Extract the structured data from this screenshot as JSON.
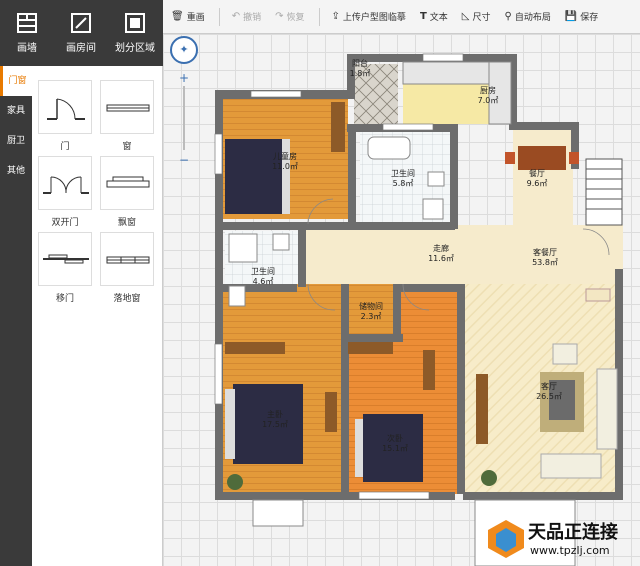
{
  "tools": [
    {
      "label": "画墙",
      "icon": "draw-wall-icon"
    },
    {
      "label": "画房间",
      "icon": "draw-room-icon"
    },
    {
      "label": "划分区域",
      "icon": "divide-area-icon"
    }
  ],
  "toolbar": [
    {
      "label": "重画",
      "icon": "trash-icon",
      "enabled": true
    },
    {
      "label": "撤销",
      "icon": "undo-icon",
      "enabled": false
    },
    {
      "label": "恢复",
      "icon": "redo-icon",
      "enabled": false
    },
    {
      "label": "上传户型图临摹",
      "icon": "upload-icon",
      "enabled": true
    },
    {
      "label": "文本",
      "icon": "text-icon",
      "enabled": true
    },
    {
      "label": "尺寸",
      "icon": "ruler-icon",
      "enabled": true
    },
    {
      "label": "自动布局",
      "icon": "pin-icon",
      "enabled": true
    },
    {
      "label": "保存",
      "icon": "save-icon",
      "enabled": true
    }
  ],
  "categories": [
    {
      "label": "门窗",
      "active": true
    },
    {
      "label": "家具",
      "active": false
    },
    {
      "label": "厨卫",
      "active": false
    },
    {
      "label": "其他",
      "active": false
    }
  ],
  "palette": [
    "门",
    "窗",
    "双开门",
    "飘窗",
    "移门",
    "落地窗"
  ],
  "zoom": {
    "plus": "+",
    "minus": "−"
  },
  "rooms": {
    "balcony_top": {
      "name": "阳台",
      "area": "1.8㎡"
    },
    "kitchen": {
      "name": "厨房",
      "area": "7.0㎡"
    },
    "children": {
      "name": "儿童房",
      "area": "11.0㎡"
    },
    "bath1": {
      "name": "卫生间",
      "area": "5.8㎡"
    },
    "dining": {
      "name": "餐厅",
      "area": "9.6㎡"
    },
    "bath2": {
      "name": "卫生间",
      "area": "4.6㎡"
    },
    "corridor": {
      "name": "走廊",
      "area": "11.6㎡"
    },
    "living_dining": {
      "name": "客餐厅",
      "area": "53.8㎡"
    },
    "storage": {
      "name": "储物间",
      "area": "2.3㎡"
    },
    "master": {
      "name": "主卧",
      "area": "17.5㎡"
    },
    "second": {
      "name": "次卧",
      "area": "15.1㎡"
    },
    "living": {
      "name": "客厅",
      "area": "26.5㎡"
    }
  },
  "watermark": {
    "title": "天品正连接",
    "url": "www.tpzlj.com"
  },
  "colors": {
    "dark": "#3a3a3a",
    "accent": "#e87a00",
    "wall": "#6d6d6d"
  }
}
